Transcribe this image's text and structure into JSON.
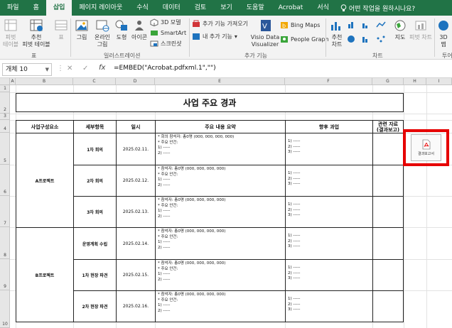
{
  "ribbon_tabs": [
    "파일",
    "홈",
    "삽입",
    "페이지 레이아웃",
    "수식",
    "데이터",
    "검토",
    "보기",
    "도움말",
    "Acrobat",
    "서식"
  ],
  "active_tab": "삽입",
  "tell_me": "어떤 작업을 원하시나요?",
  "ribbon": {
    "pivot": "피벗\n테이블",
    "rec_pivot": "추천\n피벗 테이블",
    "table": "표",
    "group_table": "표",
    "picture": "그림",
    "online_picture": "온라인\n그림",
    "shapes": "도형",
    "icons": "아이콘",
    "model3d": "3D 모델",
    "smartart": "SmartArt",
    "screenshot": "스크린샷",
    "group_illust": "일러스트레이션",
    "get_addins": "추가 기능 가져오기",
    "my_addins": "내 추가 기능",
    "visio": "Visio Data\nVisualizer",
    "bing": "Bing Maps",
    "people": "People Graph",
    "group_addins": "추가 기능",
    "rec_charts": "추천\n차트",
    "group_charts": "차트",
    "maps": "지도",
    "pivot_chart": "피벗 차트",
    "map3d": "3D\n맵",
    "group_tour": "투어"
  },
  "formula_bar": {
    "name_box": "개체 10",
    "formula": "=EMBED(\"Acrobat.pdfxml.1\",\"\")"
  },
  "columns": [
    "A",
    "B",
    "C",
    "D",
    "E",
    "F",
    "G",
    "H",
    "I"
  ],
  "rows": [
    "1",
    "2",
    "3",
    "4",
    "5",
    "6",
    "7",
    "8",
    "9",
    "10"
  ],
  "sheet": {
    "title": "사업 주요 경과",
    "headers": {
      "component": "사업구성요소",
      "detail": "세부항목",
      "date": "일시",
      "summary": "주요 내용 요약",
      "future": "향후 과업",
      "related": "관련 자료\n(결과보고)"
    },
    "projects": [
      "A프로젝트",
      "B프로젝트"
    ],
    "items": [
      {
        "name": "1차 회의",
        "date": "2025.02.11.",
        "summary": [
          "* 회의 참석자: 총0명 (000, 000, 000, 000)",
          "* 주요 안건:",
          "1) -----",
          "2) -----"
        ],
        "future": [
          "1) -----",
          "2) -----",
          "3) -----"
        ]
      },
      {
        "name": "2차 회의",
        "date": "2025.02.12.",
        "summary": [
          "* 참석자: 총0명 (000, 000, 000, 000)",
          "* 주요 안건:",
          "1) -----",
          "2) -----"
        ],
        "future": [
          "1) -----",
          "2) -----",
          "3) -----"
        ]
      },
      {
        "name": "3차 회의",
        "date": "2025.02.13.",
        "summary": [
          "* 참석자: 총0명 (000, 000, 000, 000)",
          "* 주요 안건:",
          "1) -----",
          "2) -----"
        ],
        "future": [
          "1) -----",
          "2) -----",
          "3) -----"
        ]
      },
      {
        "name": "운영계획 수립",
        "date": "2025.02.14.",
        "summary": [
          "* 참석자: 총0명 (000, 000, 000, 000)",
          "* 주요 안건:",
          "1) -----",
          "2) -----"
        ],
        "future": [
          "1) -----",
          "2) -----",
          "3) -----"
        ]
      },
      {
        "name": "1차 현장 파견",
        "date": "2025.02.15.",
        "summary": [
          "* 참석자: 총0명 (000, 000, 000, 000)",
          "* 주요 안건:",
          "1) -----",
          "2) -----"
        ],
        "future": [
          "1) -----",
          "2) -----",
          "3) -----"
        ]
      },
      {
        "name": "2차 현장 파견",
        "date": "2025.02.16.",
        "summary": [
          "* 참석자: 총0명 (000, 000, 000, 000)",
          "* 주요 안건:",
          "1) -----",
          "2) -----"
        ],
        "future": [
          "1) -----",
          "2) -----",
          "3) -----"
        ]
      }
    ],
    "embedded_label": "결과보고서"
  },
  "colors": {
    "excel_green": "#217346",
    "highlight_red": "#e60000"
  }
}
